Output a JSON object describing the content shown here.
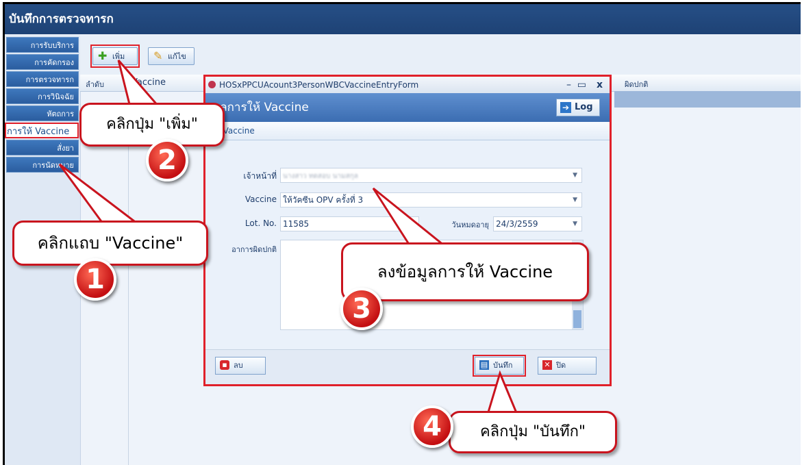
{
  "window": {
    "title": "บันทึกการตรวจทารก"
  },
  "sidebar": {
    "items": [
      {
        "label": "การรับบริการ"
      },
      {
        "label": "การคัดกรอง"
      },
      {
        "label": "การตรวจทารก"
      },
      {
        "label": "การวินิจฉัย"
      },
      {
        "label": "หัตถการ"
      },
      {
        "label": "การให้ Vaccine"
      },
      {
        "label": "สั่งยา"
      },
      {
        "label": "การนัดหมาย"
      }
    ]
  },
  "toolbar": {
    "add_label": "เพิ่ม",
    "edit_label": "แก้ไข"
  },
  "grid": {
    "col1": "ลำดับ",
    "col2": "Vaccine",
    "col3": "ผิดปกติ"
  },
  "dialog": {
    "window_title": "HOSxPPCUAcount3PersonWBCVaccineEntryForm",
    "header": "มูลการให้ Vaccine",
    "log_label": "Log",
    "subtitle": "ให้ Vaccine",
    "fields": {
      "staff_label": "เจ้าหน้าที่",
      "staff_value": "นางสาว ทดสอบ นามสกุล",
      "vaccine_label": "Vaccine",
      "vaccine_value": "ให้วัคซีน OPV ครั้งที่ 3",
      "lot_label": "Lot. No.",
      "lot_value": "11585",
      "expire_label": "วันหมดอายุ",
      "expire_value": "24/3/2559",
      "symptom_label": "อาการผิดปกติ"
    },
    "delete_label": "ลบ",
    "save_label": "บันทึก",
    "close_label": "ปิด"
  },
  "callouts": {
    "c1": "คลิกแถบ \"Vaccine\"",
    "c2": "คลิกปุ่ม \"เพิ่ม\"",
    "c3": "ลงข้อมูลการให้ Vaccine",
    "c4": "คลิกปุ่ม \"บันทึก\""
  },
  "badges": {
    "b1": "1",
    "b2": "2",
    "b3": "3",
    "b4": "4"
  },
  "colors": {
    "brand": "#1e4275",
    "highlight": "#e0202a",
    "accent": "#3b6db2"
  }
}
